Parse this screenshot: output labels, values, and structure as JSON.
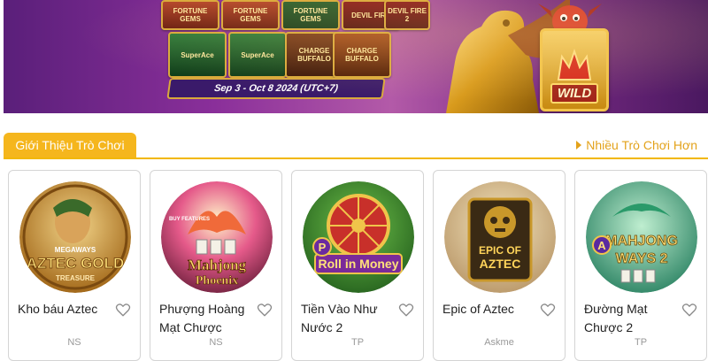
{
  "banner": {
    "tiles": [
      "FORTUNE GEMS",
      "FORTUNE GEMS",
      "FORTUNE GEMS",
      "DEVIL FIRE",
      "DEVIL FIRE 2",
      "SuperAce",
      "SuperAce",
      "CHARGE BUFFALO",
      "CHARGE BUFFALO"
    ],
    "date_range": "Sep 3 - Oct 8 2024 (UTC+7)",
    "wild_label": "WILD"
  },
  "section": {
    "title": "Giới Thiệu Trò Chơi",
    "more_link": "Nhiều Trò Chơi Hơn"
  },
  "games": [
    {
      "name": "Kho báu Aztec",
      "provider": "NS",
      "art_title": "AZTEC GOLD",
      "art_sub": "TREASURE",
      "art_tag": "MEGAWAYS"
    },
    {
      "name": "Phượng Hoàng Mạt Chược",
      "provider": "NS",
      "art_title": "Mahjong",
      "art_sub": "Phoenix",
      "art_tag": "BUY FEATURES"
    },
    {
      "name": "Tiền Vào Như Nước 2",
      "provider": "TP",
      "art_title": "Roll in Money",
      "art_sub": "",
      "art_tag": "P"
    },
    {
      "name": "Epic of Aztec",
      "provider": "Askme",
      "art_title": "EPIC OF",
      "art_sub": "AZTEC",
      "art_tag": ""
    },
    {
      "name": "Đường Mạt Chược 2",
      "provider": "TP",
      "art_title": "MAHJONG",
      "art_sub": "WAYS 2",
      "art_tag": "A"
    }
  ],
  "colors": {
    "accent": "#f5b61d",
    "link": "#e3a21a",
    "banner_purple": "#8a2f9a"
  }
}
